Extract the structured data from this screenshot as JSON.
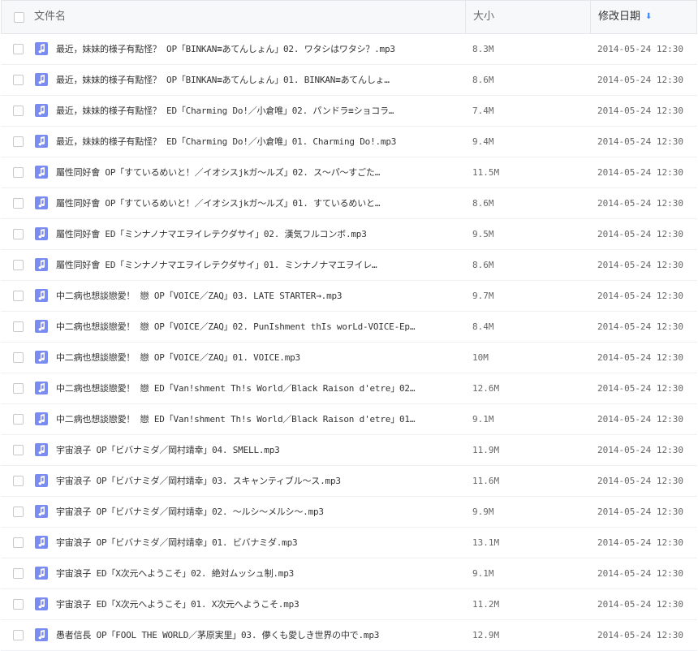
{
  "header": {
    "name_label": "文件名",
    "size_label": "大小",
    "date_label": "修改日期",
    "sort_icon": "sort-down-arrow-icon",
    "accent_color": "#3b8cff"
  },
  "icon_color": "#7a8cf2",
  "files": [
    {
      "name": "最近，妹妹的様子有點怪？ OP「BINKAN≡あてんしょん」02. ワタシはワタシ？.mp3",
      "size": "8.3M",
      "date": "2014-05-24 12:30"
    },
    {
      "name": "最近，妹妹的様子有點怪？ OP「BINKAN≡あてんしょん」01. BINKAN≡あてんしょ…",
      "size": "8.6M",
      "date": "2014-05-24 12:30"
    },
    {
      "name": "最近，妹妹的様子有點怪？ ED「Charming Do!／小倉唯」02. パンドラ≡ショコラ…",
      "size": "7.4M",
      "date": "2014-05-24 12:30"
    },
    {
      "name": "最近，妹妹的様子有點怪？ ED「Charming Do!／小倉唯」01. Charming Do!.mp3",
      "size": "9.4M",
      "date": "2014-05-24 12:30"
    },
    {
      "name": "屬性同好會 OP「すているめいと！／イオシスjkガ〜ルズ」02. ス〜パ〜すごた…",
      "size": "11.5M",
      "date": "2014-05-24 12:30"
    },
    {
      "name": "屬性同好會 OP「すているめいと！／イオシスjkガ〜ルズ」01. すているめいと…",
      "size": "8.6M",
      "date": "2014-05-24 12:30"
    },
    {
      "name": "屬性同好會 ED「ミンナノナマエヲイレテクダサイ」02. 漢気フルコンボ.mp3",
      "size": "9.5M",
      "date": "2014-05-24 12:30"
    },
    {
      "name": "屬性同好會 ED「ミンナノナマエヲイレテクダサイ」01. ミンナノナマエヲイレ…",
      "size": "8.6M",
      "date": "2014-05-24 12:30"
    },
    {
      "name": "中二病也想談戀愛！ 戀 OP「VOICE／ZAQ」03. LATE STARTER→.mp3",
      "size": "9.7M",
      "date": "2014-05-24 12:30"
    },
    {
      "name": "中二病也想談戀愛！ 戀 OP「VOICE／ZAQ」02. PunIshment thIs worLd-VOICE-Ep…",
      "size": "8.4M",
      "date": "2014-05-24 12:30"
    },
    {
      "name": "中二病也想談戀愛！ 戀 OP「VOICE／ZAQ」01. VOICE.mp3",
      "size": "10M",
      "date": "2014-05-24 12:30"
    },
    {
      "name": "中二病也想談戀愛！ 戀 ED「Van!shment Th!s World／Black Raison d'etre」02…",
      "size": "12.6M",
      "date": "2014-05-24 12:30"
    },
    {
      "name": "中二病也想談戀愛！ 戀 ED「Van!shment Th!s World／Black Raison d'etre」01…",
      "size": "9.1M",
      "date": "2014-05-24 12:30"
    },
    {
      "name": "宇宙浪子 OP「ビバナミダ／岡村靖幸」04. SMELL.mp3",
      "size": "11.9M",
      "date": "2014-05-24 12:30"
    },
    {
      "name": "宇宙浪子 OP「ビバナミダ／岡村靖幸」03. スキャンティブル〜ス.mp3",
      "size": "11.6M",
      "date": "2014-05-24 12:30"
    },
    {
      "name": "宇宙浪子 OP「ビバナミダ／岡村靖幸」02. 〜ルシ〜メルシ〜.mp3",
      "size": "9.9M",
      "date": "2014-05-24 12:30"
    },
    {
      "name": "宇宙浪子 OP「ビバナミダ／岡村靖幸」01. ビバナミダ.mp3",
      "size": "13.1M",
      "date": "2014-05-24 12:30"
    },
    {
      "name": "宇宙浪子 ED「X次元へようこそ」02. 絶対ムッシュ制.mp3",
      "size": "9.1M",
      "date": "2014-05-24 12:30"
    },
    {
      "name": "宇宙浪子 ED「X次元へようこそ」01. X次元へようこそ.mp3",
      "size": "11.2M",
      "date": "2014-05-24 12:30"
    },
    {
      "name": "愚者信長 OP「FOOL THE WORLD／茅原実里」03. 儚くも愛しき世界の中で.mp3",
      "size": "12.9M",
      "date": "2014-05-24 12:30"
    }
  ]
}
